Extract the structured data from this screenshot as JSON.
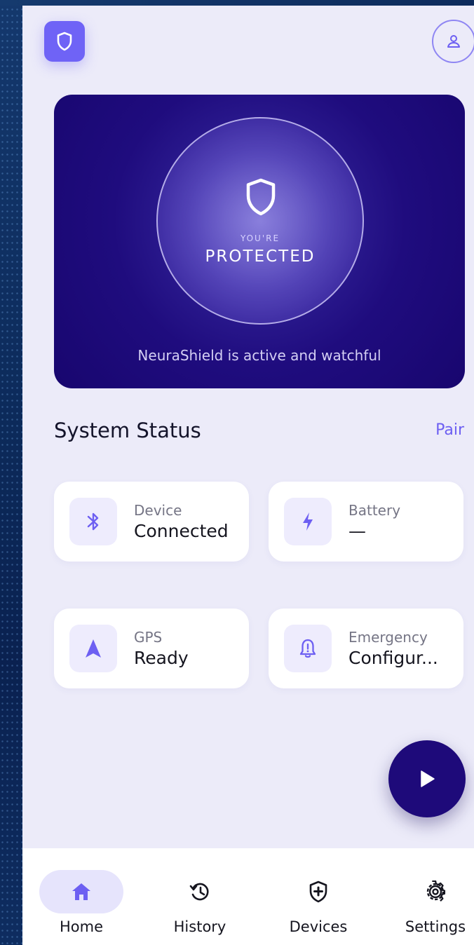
{
  "header": {
    "logo_icon": "shield-icon",
    "profile_icon": "user-icon"
  },
  "hero": {
    "status_small": "YOU'RE",
    "status_big": "PROTECTED",
    "caption": "NeuraShield is active and watchful",
    "shield_icon": "shield-outline-icon"
  },
  "status": {
    "title": "System Status",
    "pair_label": "Pair",
    "cards": [
      {
        "label": "Device",
        "value": "Connected",
        "icon": "bluetooth-icon"
      },
      {
        "label": "Battery",
        "value": "—",
        "icon": "lightning-icon"
      },
      {
        "label": "GPS",
        "value": "Ready",
        "icon": "navigation-arrow-icon"
      },
      {
        "label": "Emergency",
        "value": "Configur...",
        "icon": "bell-alert-icon"
      }
    ]
  },
  "fab": {
    "icon": "play-icon"
  },
  "nav": {
    "items": [
      {
        "label": "Home",
        "icon": "home-icon",
        "active": true
      },
      {
        "label": "History",
        "icon": "history-icon",
        "active": false
      },
      {
        "label": "Devices",
        "icon": "shield-plus-icon",
        "active": false
      },
      {
        "label": "Settings",
        "icon": "gear-icon",
        "active": false
      }
    ]
  },
  "colors": {
    "accent": "#6f63f6",
    "hero_dark": "#18066f",
    "background": "#ecebf9",
    "fab": "#1e0a7a"
  }
}
